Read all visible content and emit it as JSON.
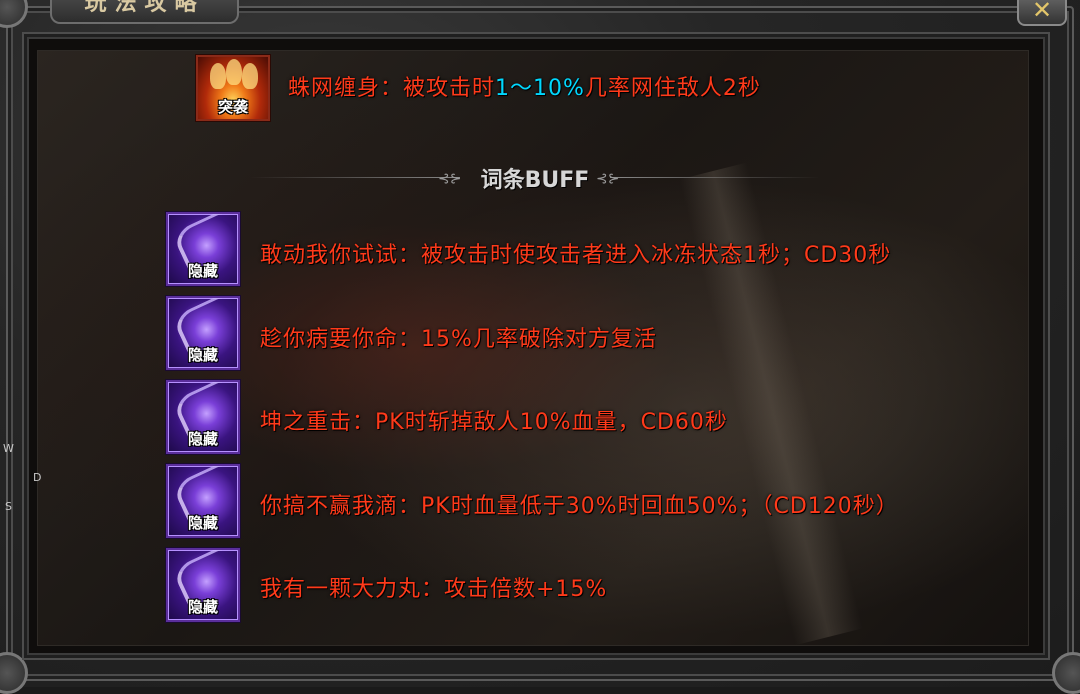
{
  "window": {
    "title": "玩法攻略",
    "close_symbol": "✕"
  },
  "top_skill": {
    "icon": "fire-icon",
    "tag": "突袭",
    "name": "蛛网缠身：被攻击时",
    "highlight": "1～10%",
    "rest": "几率网住敌人2秒"
  },
  "section": {
    "title": "词条BUFF"
  },
  "buffs": [
    {
      "tag": "隐藏",
      "icon": "purple-swirl-icon",
      "text": "敢动我你试试：被攻击时使攻击者进入冰冻状态1秒；CD30秒"
    },
    {
      "tag": "隐藏",
      "icon": "purple-swirl-icon",
      "text": "趁你病要你命：15%几率破除对方复活"
    },
    {
      "tag": "隐藏",
      "icon": "purple-swirl-icon",
      "text": "坤之重击：PK时斩掉敌人10%血量，CD60秒"
    },
    {
      "tag": "隐藏",
      "icon": "purple-swirl-icon",
      "text": "你搞不赢我滴：PK时血量低于30%时回血50%；（CD120秒）"
    },
    {
      "tag": "隐藏",
      "icon": "purple-swirl-icon",
      "text": "我有一颗大力丸：攻击倍数+15%"
    }
  ],
  "side_letters": [
    "W",
    "D",
    "S"
  ],
  "colors": {
    "buff_text": "#ff3a1a",
    "highlight": "#00d8ff",
    "section_title": "#d7d7d7"
  }
}
